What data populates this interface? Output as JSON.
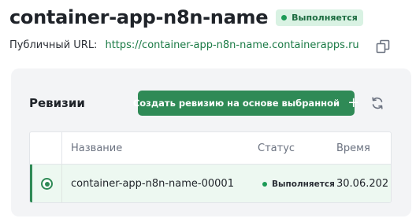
{
  "app": {
    "title": "container-app-n8n-name",
    "status": "Выполняется",
    "status_color": "#1c9a56"
  },
  "url": {
    "label": "Публичный URL:",
    "value": "https://container-app-n8n-name.containerapps.ru",
    "copy_icon": "copy-icon"
  },
  "revisions": {
    "title": "Ревизии",
    "create_button_label": "Создать ревизию на основе выбранной",
    "create_button_icon": "plus",
    "refresh_icon": "refresh-icon",
    "accent": "#2f8a56",
    "columns": [
      "Название",
      "Статус",
      "Время"
    ],
    "rows": [
      {
        "name": "container-app-n8n-name-00001",
        "status": "Выполняется",
        "time": "30.06.202",
        "selected": true
      }
    ]
  }
}
